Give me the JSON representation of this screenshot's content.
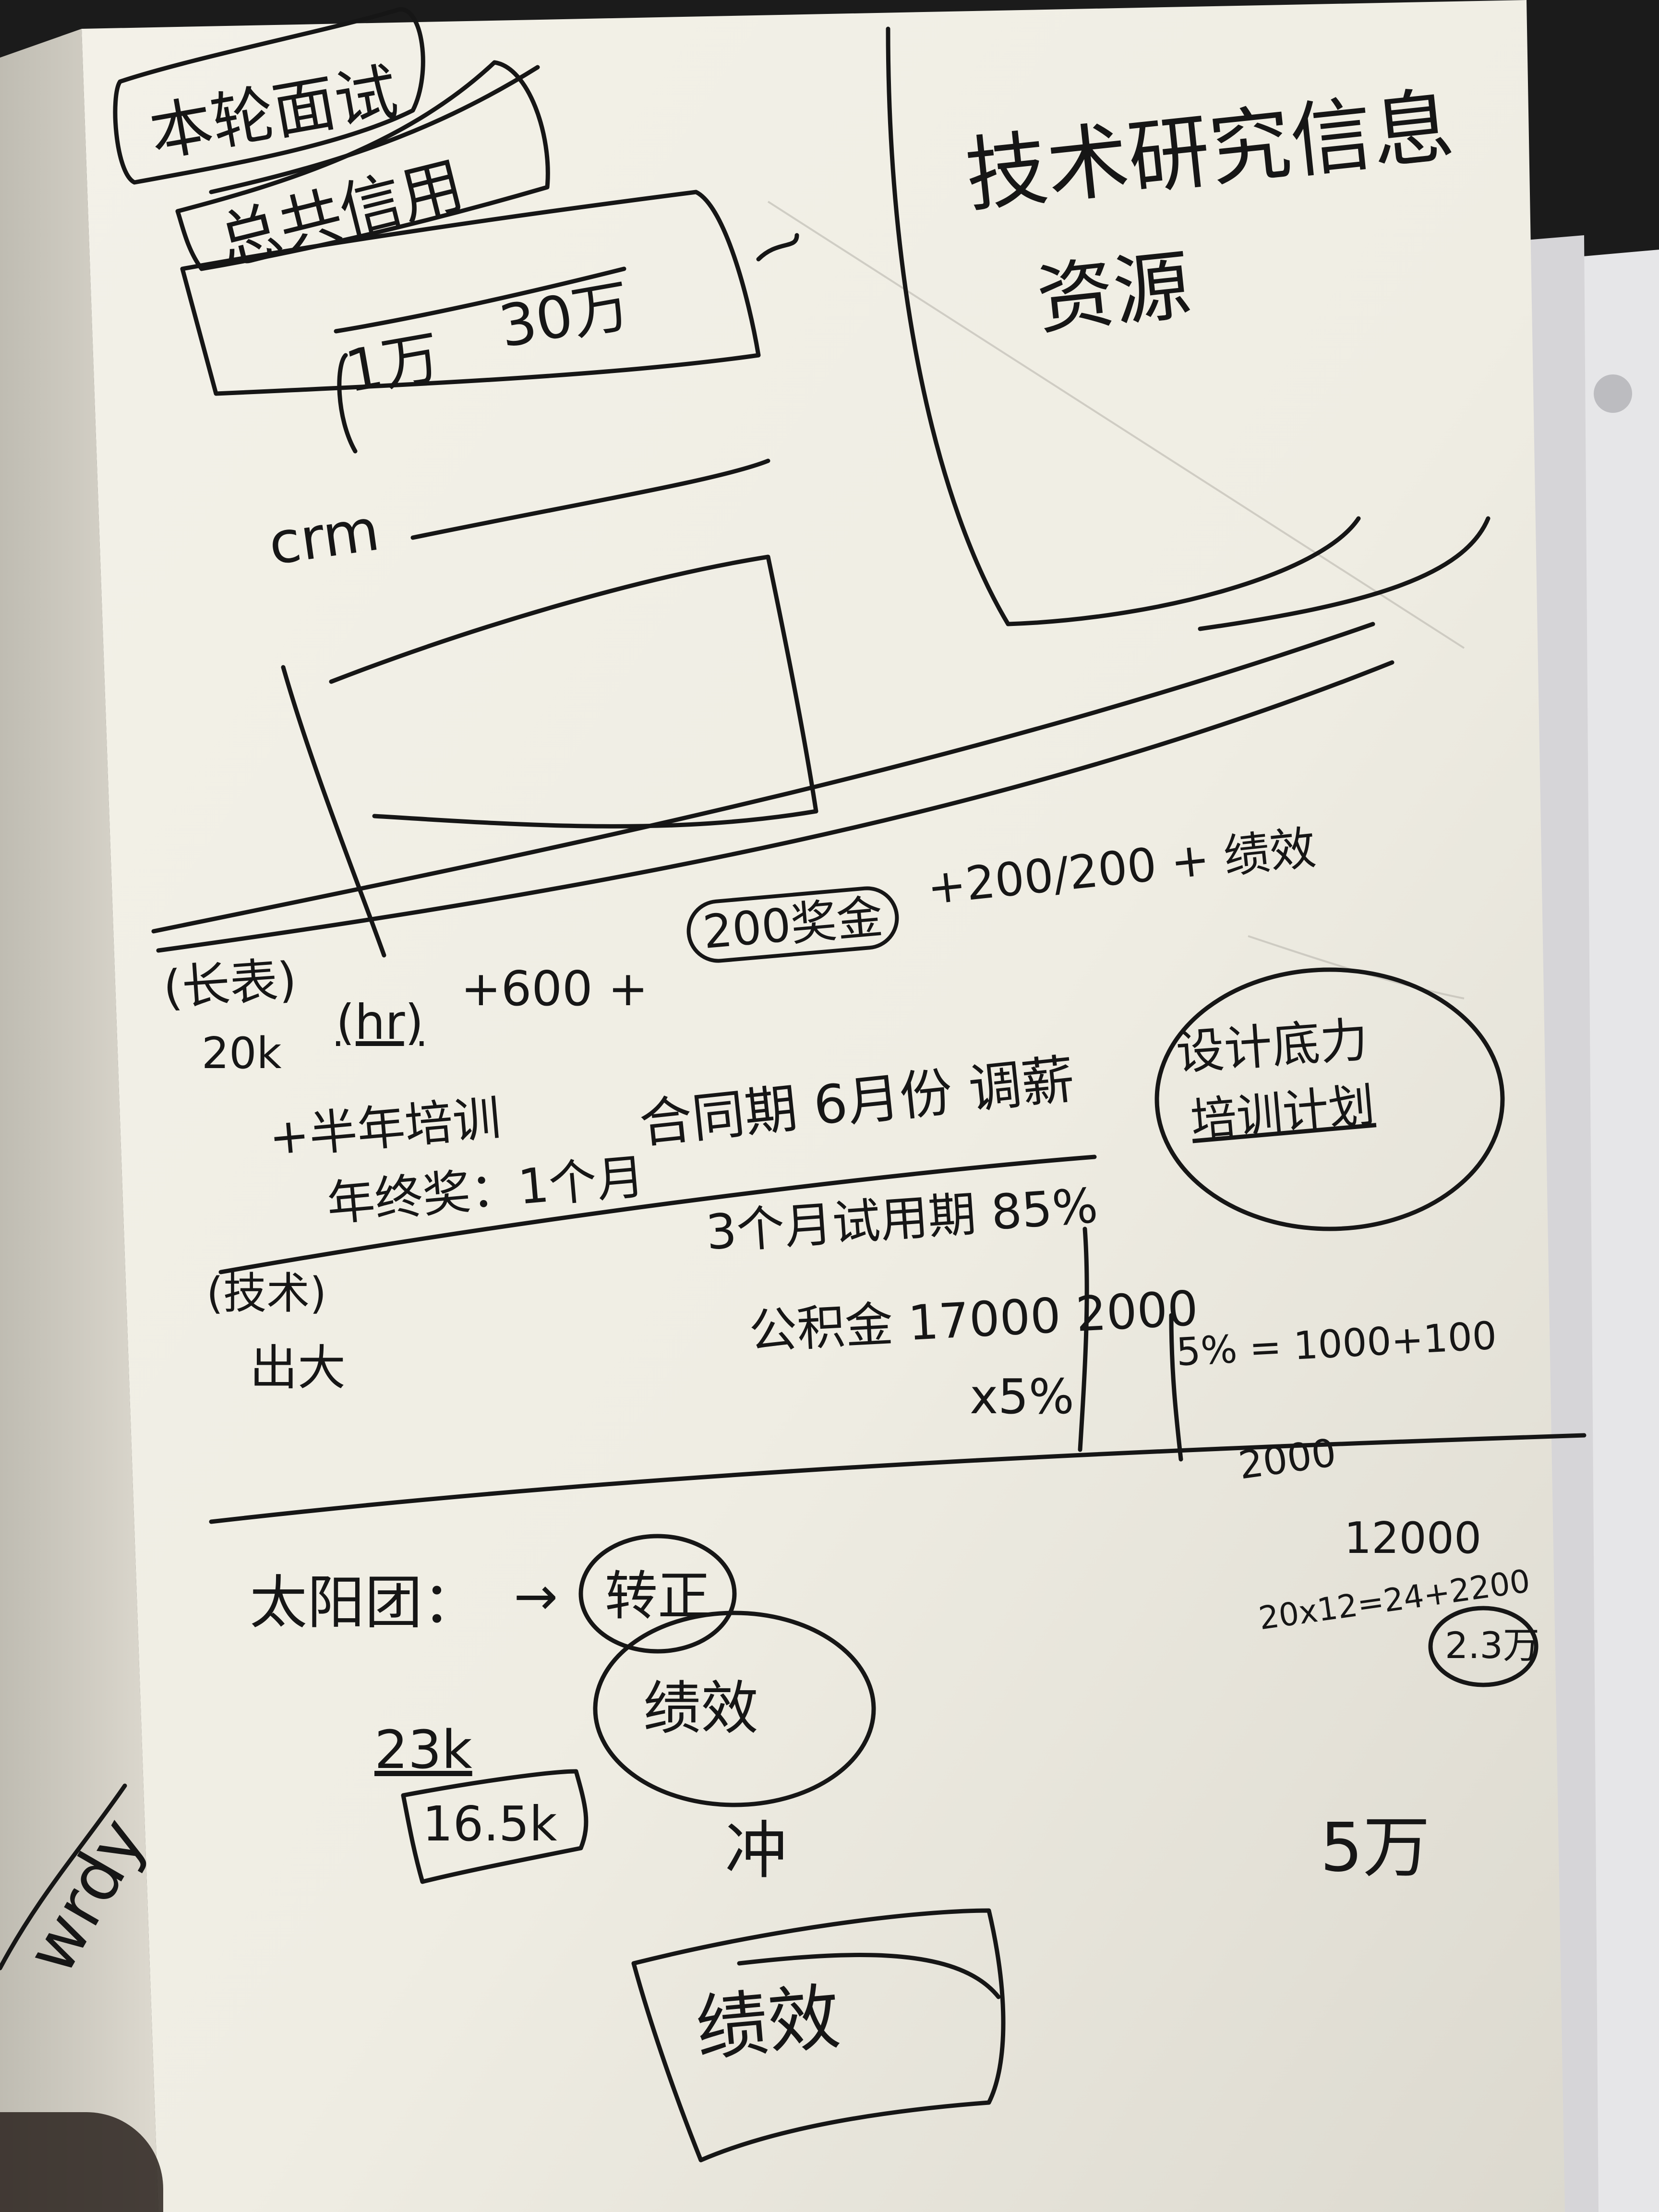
{
  "notebook": {
    "left_margin_text": "wrdy",
    "block_top": {
      "items": [
        "本轮面试",
        "总共信用",
        "1万",
        "30万"
      ],
      "label": "crm"
    },
    "right_note": {
      "line1": "技术研究信息",
      "line2": "资源"
    },
    "row1": {
      "tag": "(长表)",
      "amount": "20k",
      "expr_parts": [
        "(hr)",
        "+600 +",
        "200奖金",
        "+200/200 + 绩效"
      ],
      "note_a": "+半年培训",
      "note_b": "合同期 6月份 调薪",
      "note_c": "年终奖：1个月",
      "bubble_line1": "设计底力",
      "bubble_line2": "培训计划"
    },
    "row2": {
      "tag": "(技术)",
      "name": "出大",
      "line1": "3个月试用期 85%",
      "line2": "公积金 17000 2000",
      "line3": "x5%",
      "line4": "5% = 1000+100"
    },
    "row3": {
      "team": "太阳团：",
      "arrow": "→",
      "circle_a": "转正",
      "amount_top": "23k",
      "amount_box": "16.5k",
      "circle_b": "绩效",
      "mid": "冲",
      "box_bottom": "绩效",
      "calc_a": "2000",
      "calc_b": "12000",
      "calc_c": "20x12=24+2200",
      "calc_d": "2.3万",
      "tail": "5万"
    }
  },
  "colors": {
    "ink": "#161616",
    "paper": "#f1efe6",
    "paper_shadow": "#d9d6cc",
    "background": "#1a1a1a"
  }
}
